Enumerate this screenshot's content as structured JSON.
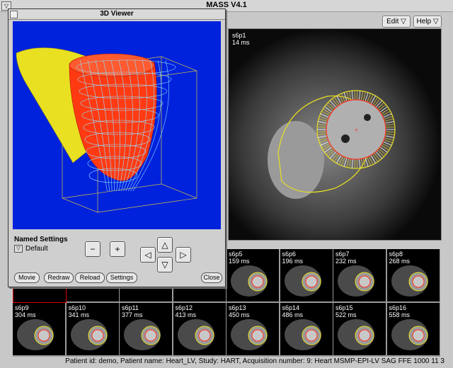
{
  "app": {
    "title": "MASS V4.1",
    "menu_glyph": "▽"
  },
  "menubar": {
    "edit_label": "Edit ▽",
    "help_label": "Help ▽"
  },
  "main_view": {
    "slice": "s6p1",
    "time": "14 ms"
  },
  "thumbnails": [
    {
      "slice": "s6p5",
      "time": "159 ms"
    },
    {
      "slice": "s6p6",
      "time": "196 ms"
    },
    {
      "slice": "s6p7",
      "time": "232 ms"
    },
    {
      "slice": "s6p8",
      "time": "268 ms"
    },
    {
      "slice": "s6p9",
      "time": "304 ms"
    },
    {
      "slice": "s6p10",
      "time": "341 ms"
    },
    {
      "slice": "s6p11",
      "time": "377 ms"
    },
    {
      "slice": "s6p12",
      "time": "413 ms"
    },
    {
      "slice": "s6p13",
      "time": "450 ms"
    },
    {
      "slice": "s6p14",
      "time": "486 ms"
    },
    {
      "slice": "s6p15",
      "time": "522 ms"
    },
    {
      "slice": "s6p16",
      "time": "558 ms"
    }
  ],
  "viewer": {
    "title": "3D Viewer",
    "named_settings_label": "Named Settings",
    "default_label": "Default",
    "toggle_glyph": "▽",
    "zoom_out_glyph": "−",
    "zoom_in_glyph": "+",
    "up_glyph": "△",
    "down_glyph": "▽",
    "left_glyph": "◁",
    "right_glyph": "▷",
    "buttons": {
      "movie": "Movie",
      "redraw": "Redraw",
      "reload": "Reload",
      "settings": "Settings",
      "close": "Close"
    }
  },
  "status": {
    "text": "Patient id: demo, Patient name: Heart_LV, Study: HART, Acquisition number: 9: Heart MSMP-EPI-LV SAG FFE 1000 11 3"
  },
  "colors": {
    "epicardium": "#e8e020",
    "endocardium": "#ff3020",
    "mesh": "#80c8ff",
    "viewer_bg": "#0022dd",
    "selected_thumb": "#dd0000"
  }
}
